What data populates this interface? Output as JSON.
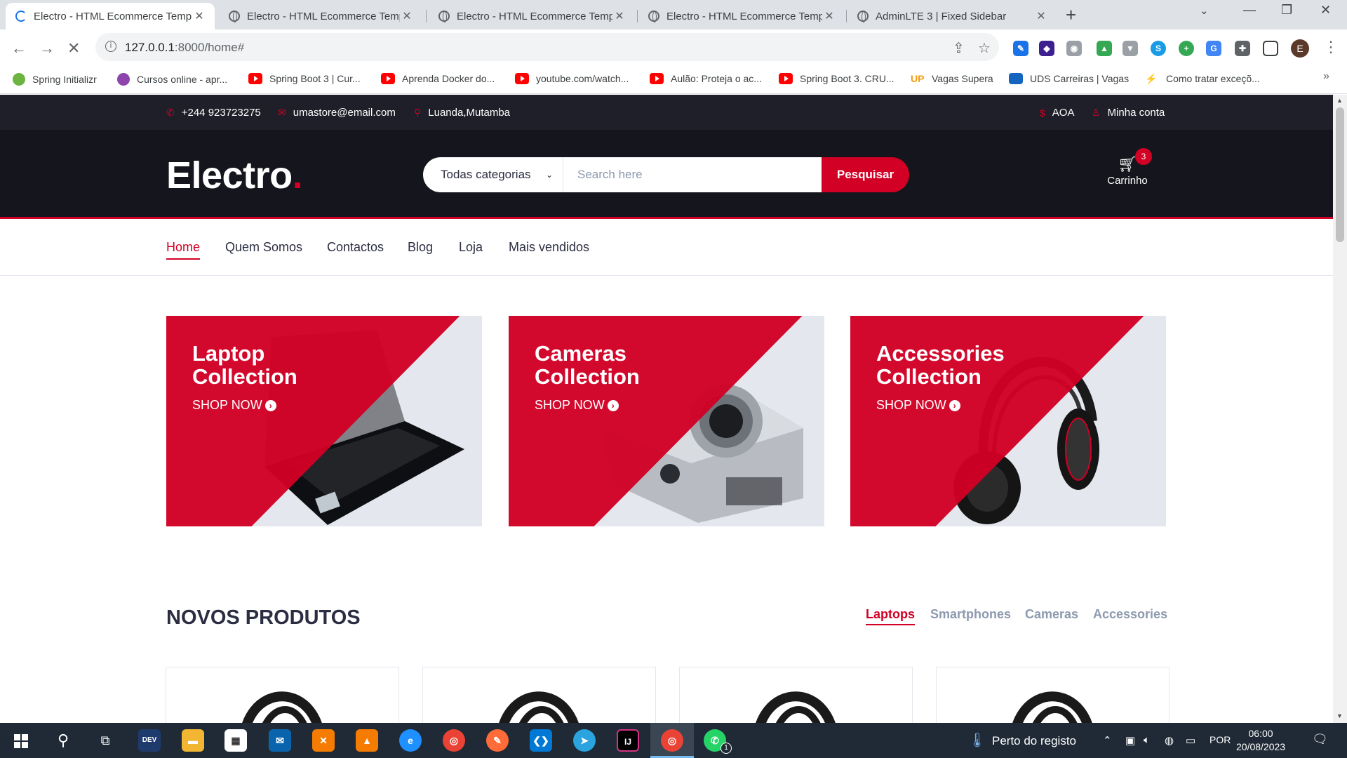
{
  "browser": {
    "tabs": [
      {
        "title": "Electro - HTML Ecommerce Temp",
        "active": true
      },
      {
        "title": "Electro - HTML Ecommerce Temp"
      },
      {
        "title": "Electro - HTML Ecommerce Temp"
      },
      {
        "title": "Electro - HTML Ecommerce Temp"
      },
      {
        "title": "AdminLTE 3 | Fixed Sidebar"
      }
    ],
    "url_host": "127.0.0.1",
    "url_path": ":8000/home#",
    "profile_initial": "E",
    "bookmarks": [
      "Spring Initializr",
      "Cursos online - apr...",
      "Spring Boot 3 | Cur...",
      "Aprenda Docker do...",
      "youtube.com/watch...",
      "Aulão: Proteja o ac...",
      "Spring Boot 3. CRU...",
      "Vagas Supera",
      "UDS Carreiras | Vagas",
      "Como tratar exceçõ..."
    ]
  },
  "topbar": {
    "phone": "+244 923723275",
    "email": "umastore@email.com",
    "location": "Luanda,Mutamba",
    "currency": "AOA",
    "account": "Minha conta"
  },
  "header": {
    "logo": "Electro",
    "logo_dot": ".",
    "category_select": "Todas categorias",
    "search_placeholder": "Search here",
    "search_button": "Pesquisar",
    "cart_count": "3",
    "cart_label": "Carrinho"
  },
  "nav": {
    "items": [
      "Home",
      "Quem Somos",
      "Contactos",
      "Blog",
      "Loja",
      "Mais vendidos"
    ]
  },
  "collections": [
    {
      "line1": "Laptop",
      "line2": "Collection",
      "cta": "SHOP NOW"
    },
    {
      "line1": "Cameras",
      "line2": "Collection",
      "cta": "SHOP NOW"
    },
    {
      "line1": "Accessories",
      "line2": "Collection",
      "cta": "SHOP NOW"
    }
  ],
  "new_products": {
    "title": "NOVOS PRODUTOS",
    "tabs": [
      "Laptops",
      "Smartphones",
      "Cameras",
      "Accessories"
    ]
  },
  "taskbar": {
    "weather": "Perto do registo",
    "lang": "POR",
    "time": "06:00",
    "date": "20/08/2023",
    "whatsapp_badge": "1"
  },
  "colors": {
    "accent": "#d10024",
    "header_dark": "#15161d",
    "topbar_dark": "#1e1f29",
    "muted": "#8d99ae"
  }
}
